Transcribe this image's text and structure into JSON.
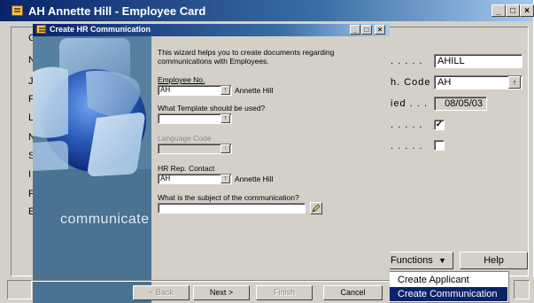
{
  "back_window": {
    "title": "AH Annette Hill - Employee Card",
    "sys_buttons": {
      "minimize": "_",
      "maximize": "□",
      "close": "×"
    },
    "left_label_stubs": [
      "G",
      "N",
      "J",
      "F",
      "L",
      "N",
      "S",
      "I",
      "F",
      "E"
    ],
    "fields": [
      {
        "label_tail": ". . . . .",
        "value": "AHILL"
      },
      {
        "label_tail": "h. Code .",
        "value": "AH"
      },
      {
        "label_tail": "ied  . . .",
        "value": "08/05/03"
      },
      {
        "label_tail": ". . . . .",
        "checked_mark": "✓"
      },
      {
        "label_tail": ". . . . .",
        "checked_mark": ""
      }
    ],
    "functions_button": "Functions",
    "help_button": "Help",
    "functions_menu": [
      "Create Applicant",
      "Create Communication"
    ],
    "selected_menu_item": "Create Communication"
  },
  "dialog": {
    "title": "Create HR Communication",
    "intro_line1": "This wizard helps you to create documents regarding",
    "intro_line2": "communications with Employees.",
    "employee_no_label": "Employee No.",
    "employee_no_value": "AH",
    "employee_name": "Annette Hill",
    "template_label": "What Template should be used?",
    "template_value": "",
    "language_code_label": "Language Code",
    "language_code_value": "",
    "hr_contact_label": "HR Rep. Contact",
    "hr_contact_value": "AH",
    "hr_contact_name": "Annette Hill",
    "subject_label": "What is the subject of the communication?",
    "subject_value": "",
    "art_word": "communicate",
    "buttons": {
      "back": "< Back",
      "next": "Next >",
      "finish": "Finish",
      "cancel": "Cancel"
    }
  },
  "colors": {
    "title_bar": "#0a246a",
    "face": "#d4d0c8",
    "selection": "#0a246a",
    "art_panel": "#5a80a0",
    "art_shape": "#2a5ab8"
  },
  "icons": [
    "app-icon",
    "lookup-arrow-icon",
    "dropdown-arrow-icon",
    "edit-pencil-icon",
    "checkmark-icon"
  ]
}
